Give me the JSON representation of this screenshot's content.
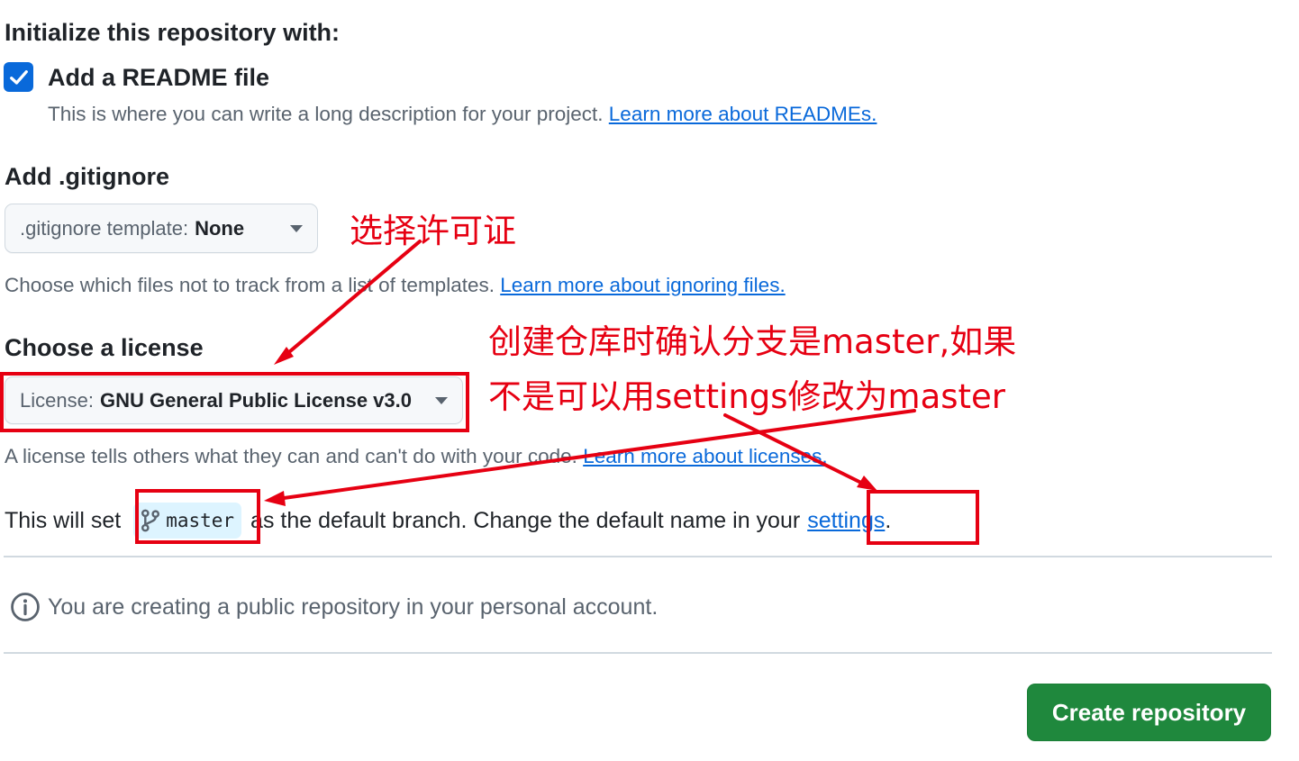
{
  "init": {
    "heading": "Initialize this repository with:",
    "readme": {
      "label": "Add a README file",
      "checked": true,
      "description": "This is where you can write a long description for your project.",
      "link": "Learn more about READMEs."
    }
  },
  "gitignore": {
    "heading": "Add .gitignore",
    "dropdown_label": ".gitignore template:",
    "dropdown_value": "None",
    "description": "Choose which files not to track from a list of templates.",
    "link": "Learn more about ignoring files."
  },
  "license": {
    "heading": "Choose a license",
    "dropdown_label": "License:",
    "dropdown_value": "GNU General Public License v3.0",
    "description": "A license tells others what they can and can't do with your code.",
    "link": "Learn more about licenses."
  },
  "branch": {
    "prefix": "This will set",
    "name": "master",
    "middle": "as the default branch. Change the default name in your",
    "link": "settings",
    "suffix": "."
  },
  "notice": {
    "text": "You are creating a public repository in your personal account."
  },
  "submit": {
    "label": "Create repository"
  },
  "annotations": {
    "license_note": "选择许可证",
    "branch_note_line1": "创建仓库时确认分支是master,如果",
    "branch_note_line2": "不是可以用settings修改为master"
  },
  "colors": {
    "accent_blue": "#0969da",
    "button_green": "#1f883d",
    "annotation_red": "#e60012",
    "badge_bg": "#ddf4ff"
  },
  "icons": {
    "checkbox": "check-icon",
    "dropdown": "triangle-down-icon",
    "branch": "git-branch-icon",
    "notice": "info-icon"
  }
}
